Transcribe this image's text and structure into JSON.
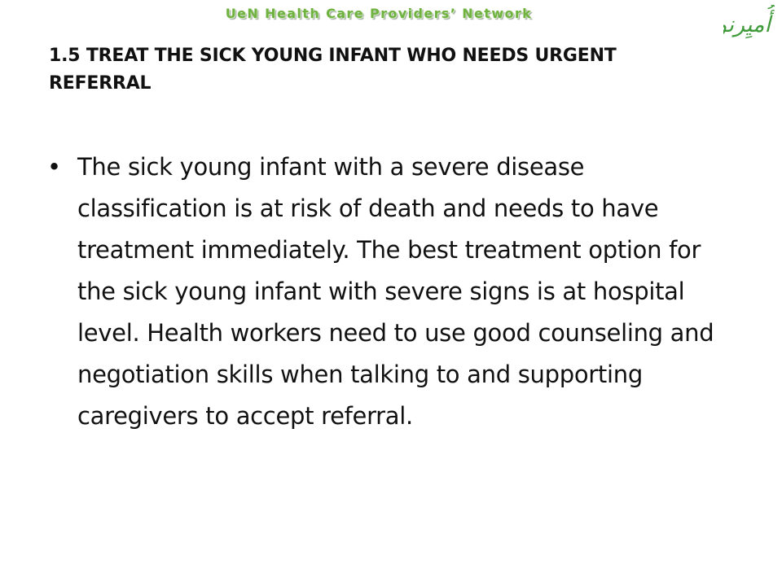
{
  "header": {
    "network_name": "UeN Health Care Providers’ Network",
    "logo_text": "أُميِرنو",
    "logo_color": "#3f9a3a",
    "network_color": "#6fb240"
  },
  "slide": {
    "title": "1.5 TREAT THE SICK YOUNG INFANT WHO NEEDS URGENT REFERRAL",
    "bullets": [
      {
        "glyph": "•",
        "text": "The sick young infant with a severe disease classification is at risk of death and needs to have treatment immediately. The best treatment option for the sick young infant with severe signs is at hospital level. Health workers need to use good counseling and negotiation skills when talking to and supporting caregivers to accept referral."
      }
    ]
  }
}
